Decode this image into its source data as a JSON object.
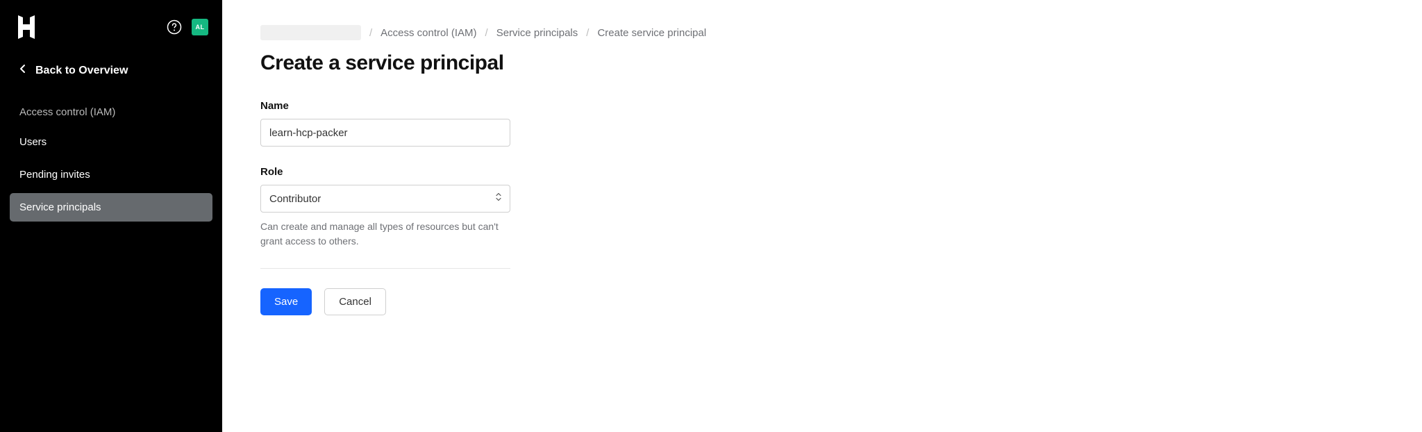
{
  "sidebar": {
    "avatar_initials": "AL",
    "back_label": "Back to Overview",
    "section_heading": "Access control (IAM)",
    "items": [
      {
        "label": "Users",
        "active": false
      },
      {
        "label": "Pending invites",
        "active": false
      },
      {
        "label": "Service principals",
        "active": true
      }
    ]
  },
  "breadcrumb": {
    "items": [
      {
        "label": "Access control (IAM)"
      },
      {
        "label": "Service principals"
      },
      {
        "label": "Create service principal"
      }
    ]
  },
  "page": {
    "title": "Create a service principal"
  },
  "form": {
    "name_label": "Name",
    "name_value": "learn-hcp-packer",
    "role_label": "Role",
    "role_value": "Contributor",
    "role_help": "Can create and manage all types of resources but can't grant access to others.",
    "save_label": "Save",
    "cancel_label": "Cancel"
  }
}
